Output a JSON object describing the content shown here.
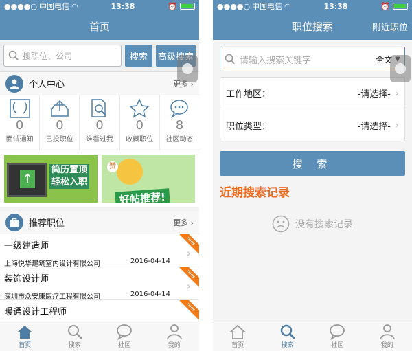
{
  "left": {
    "status": {
      "carrier": "中国电信",
      "time": "13:38"
    },
    "nav": {
      "title": "首页"
    },
    "search": {
      "placeholder": "搜职位、公司",
      "search_label": "搜索",
      "advanced_label": "高级搜索"
    },
    "personal": {
      "title": "个人中心",
      "more": "更多",
      "stats": [
        {
          "count": "0",
          "label": "面试通知",
          "icon": "profile-faces-icon"
        },
        {
          "count": "0",
          "label": "已投职位",
          "icon": "tray-upload-icon"
        },
        {
          "count": "0",
          "label": "谁看过我",
          "icon": "document-search-icon"
        },
        {
          "count": "0",
          "label": "收藏职位",
          "icon": "star-icon"
        },
        {
          "count": "8",
          "label": "社区动态",
          "icon": "chat-bubble-icon"
        }
      ]
    },
    "banners": [
      {
        "text_line1": "简历置顶",
        "text_line2": "轻松入职"
      },
      {
        "text_main": "好帖推荐!",
        "text_tag": "赞"
      }
    ],
    "recommend": {
      "title": "推荐职位",
      "more": "更多",
      "jobs": [
        {
          "title": "一级建造师",
          "company": "上海悦华建筑室内设计有限公司",
          "date": "2016-04-14",
          "tag": "new"
        },
        {
          "title": "装饰设计师",
          "company": "深圳市众安康医疗工程有限公司",
          "date": "2016-04-14",
          "tag": "new"
        },
        {
          "title": "暖通设计工程师",
          "company": "",
          "date": "",
          "tag": "new"
        }
      ]
    },
    "tabs": [
      {
        "label": "首页",
        "active": true
      },
      {
        "label": "搜索",
        "active": false
      },
      {
        "label": "社区",
        "active": false
      },
      {
        "label": "我的",
        "active": false
      }
    ]
  },
  "right": {
    "status": {
      "carrier": "中国电信",
      "time": "13:38"
    },
    "nav": {
      "title": "职位搜索",
      "right": "附近职位"
    },
    "keyword": {
      "placeholder": "请输入搜索关键字",
      "mode": "全文"
    },
    "selects": [
      {
        "label": "工作地区：",
        "value": "-请选择-"
      },
      {
        "label": "职位类型：",
        "value": "-请选择-"
      }
    ],
    "search_label": "搜 索",
    "recent_title": "近期搜索记录",
    "empty_text": "没有搜索记录",
    "tabs": [
      {
        "label": "首页",
        "active": false
      },
      {
        "label": "搜索",
        "active": true
      },
      {
        "label": "社区",
        "active": false
      },
      {
        "label": "我的",
        "active": false
      }
    ]
  },
  "colors": {
    "primary": "#5b8fb8",
    "accent": "#f06a1e",
    "new_tag": "#f07a1a"
  }
}
